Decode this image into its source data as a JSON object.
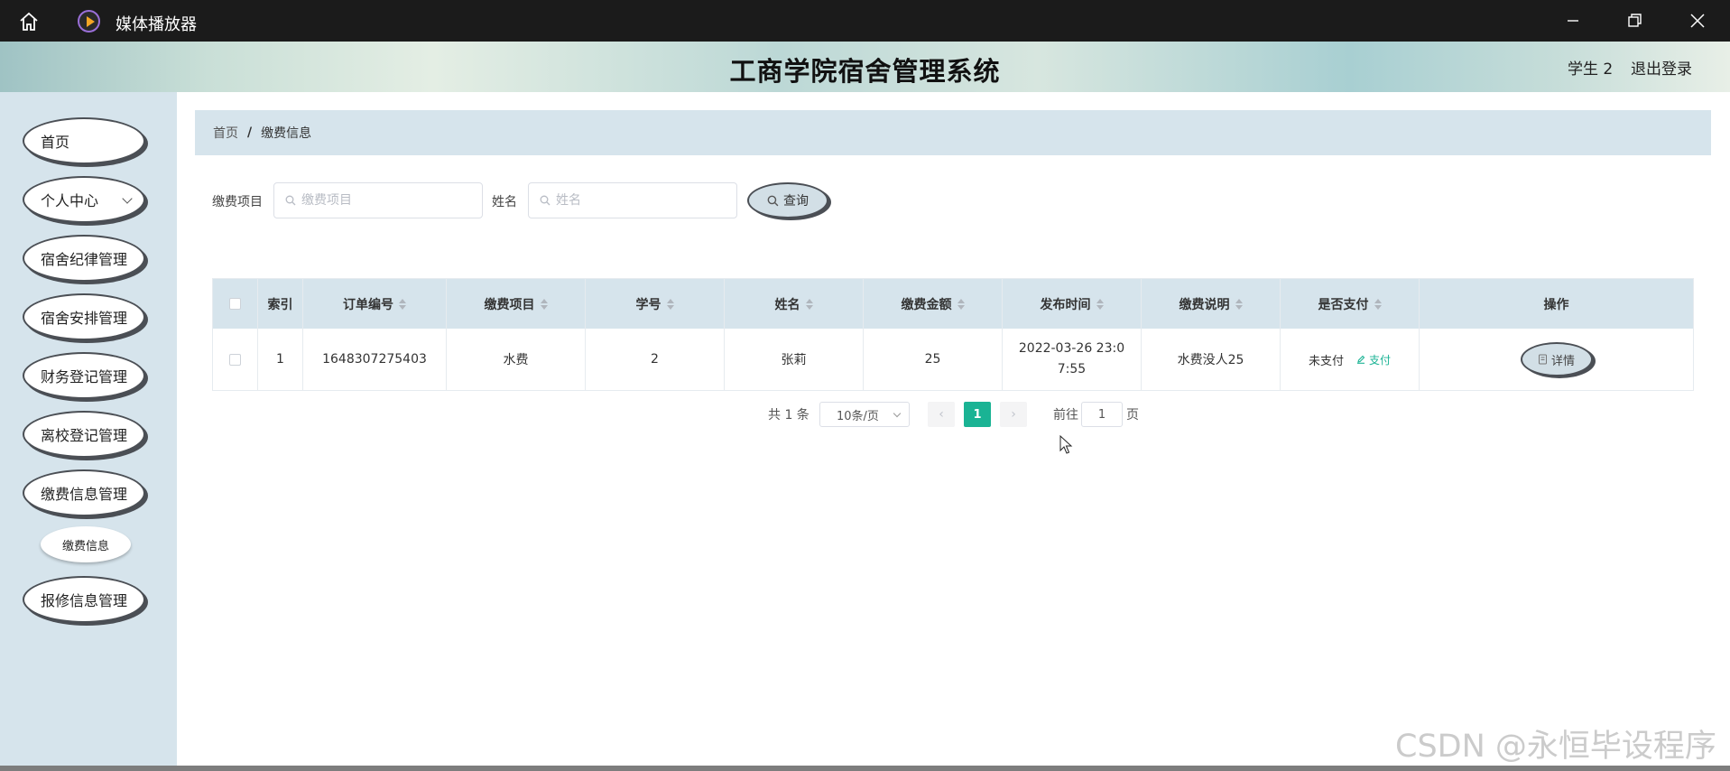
{
  "window": {
    "title": "媒体播放器"
  },
  "header": {
    "system_title": "工商学院宿舍管理系统",
    "user": "学生 2",
    "logout": "退出登录"
  },
  "sidebar": {
    "items": [
      {
        "label": "首页"
      },
      {
        "label": "个人中心"
      },
      {
        "label": "宿舍纪律管理"
      },
      {
        "label": "宿舍安排管理"
      },
      {
        "label": "财务登记管理"
      },
      {
        "label": "离校登记管理"
      },
      {
        "label": "缴费信息管理"
      },
      {
        "label": "报修信息管理"
      }
    ],
    "submenu_active": "缴费信息"
  },
  "breadcrumb": {
    "home": "首页",
    "separator": "/",
    "current": "缴费信息"
  },
  "search": {
    "item_label": "缴费项目",
    "item_placeholder": "缴费项目",
    "name_label": "姓名",
    "name_placeholder": "姓名",
    "button": "查询"
  },
  "table": {
    "columns": [
      "索引",
      "订单编号",
      "缴费项目",
      "学号",
      "姓名",
      "缴费金额",
      "发布时间",
      "缴费说明",
      "是否支付",
      "操作"
    ],
    "rows": [
      {
        "index": "1",
        "order_no": "1648307275403",
        "item": "水费",
        "student_no": "2",
        "name": "张莉",
        "amount": "25",
        "time": "2022-03-26 23:07:55",
        "desc": "水费没人25",
        "paid": "未支付",
        "pay_action": "支付",
        "detail_action": "详情"
      }
    ]
  },
  "pagination": {
    "total": "共 1 条",
    "page_size": "10条/页",
    "current": "1",
    "goto_label": "前往",
    "goto_value": "1",
    "page_suffix": "页"
  },
  "watermark": "CSDN @永恒毕设程序",
  "colors": {
    "accent": "#1ab394",
    "sidebar_bg": "#d6e4ec",
    "titlebar_bg": "#1b1b1b"
  }
}
